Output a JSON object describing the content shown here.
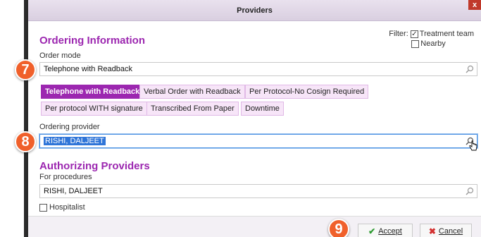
{
  "window": {
    "title": "Providers",
    "close_label": "x"
  },
  "ordering": {
    "heading": "Ordering Information",
    "order_mode_label": "Order mode",
    "order_mode_value": "Telephone with Readback",
    "modes": [
      "Telephone with Readback",
      "Verbal Order with Readback",
      "Per Protocol-No Cosign Required",
      "Per protocol WITH signature",
      "Transcribed From Paper",
      "Downtime"
    ],
    "active_mode": "Telephone with Readback",
    "provider_label": "Ordering provider",
    "provider_value": "RISHI, DALJEET"
  },
  "filter": {
    "label": "Filter:",
    "treatment_team": {
      "label": "Treatment team",
      "checked": true
    },
    "nearby": {
      "label": "Nearby",
      "checked": false
    }
  },
  "authorizing": {
    "heading": "Authorizing Providers",
    "procedures_label": "For procedures",
    "procedures_value": "RISHI, DALJEET",
    "hospitalist_label": "Hospitalist",
    "hospitalist_checked": false
  },
  "badges": [
    "7",
    "8",
    "9"
  ],
  "footer": {
    "accept_label": "Accept",
    "cancel_label": "Cancel"
  },
  "colors": {
    "accent": "#9c27b0",
    "badge": "#f0602b",
    "selection": "#2f75d8"
  },
  "icons": {
    "search": "search-icon",
    "cursor": "hand-cursor-icon",
    "accept": "check-icon",
    "cancel": "x-icon"
  }
}
